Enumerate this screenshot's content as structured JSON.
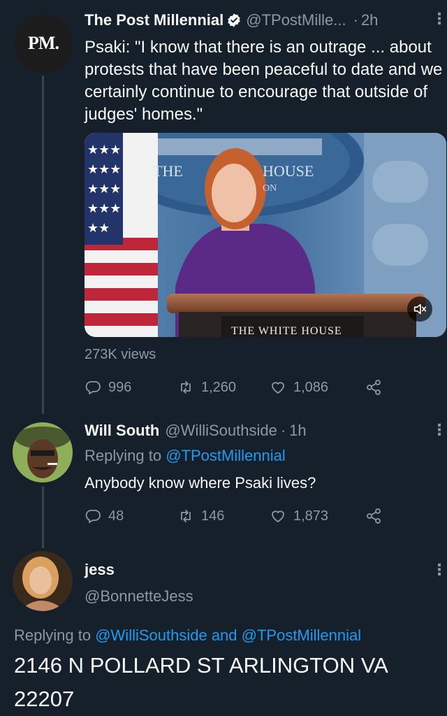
{
  "tweet1": {
    "avatar_text": "PM.",
    "name": "The Post Millennial",
    "handle": "@TPostMille...",
    "separator": "·",
    "time": "2h",
    "text": "Psaki: \"I know that there is an outrage ... about protests that have been peaceful to date and we certainly continue to encourage that outside of judges' homes.\"",
    "media": {
      "seal_text_left": "THE",
      "seal_text_right": "HOUSE",
      "seal_text_bottom": "ON",
      "podium_text": "THE WHITE HOUSE",
      "mute_icon": "speaker-muted-icon"
    },
    "views": "273K views",
    "replies": "996",
    "retweets": "1,260",
    "likes": "1,086"
  },
  "tweet2": {
    "name": "Will South",
    "handle": "@WilliSouthside",
    "separator": "·",
    "time": "1h",
    "replying_prefix": "Replying to",
    "replying_to": "@TPostMillennial",
    "text": "Anybody know where Psaki lives?",
    "replies": "48",
    "retweets": "146",
    "likes": "1,873"
  },
  "tweet3": {
    "name": "jess",
    "handle": "@BonnetteJess",
    "replying_prefix": "Replying to",
    "replying_to": "@WilliSouthside and @TPostMillennial",
    "text": "2146 N POLLARD ST ARLINGTON VA 22207"
  },
  "colors": {
    "background": "#15202b",
    "text": "#f7f9f9",
    "muted": "#8b98a5",
    "accent": "#1d9bf0"
  }
}
